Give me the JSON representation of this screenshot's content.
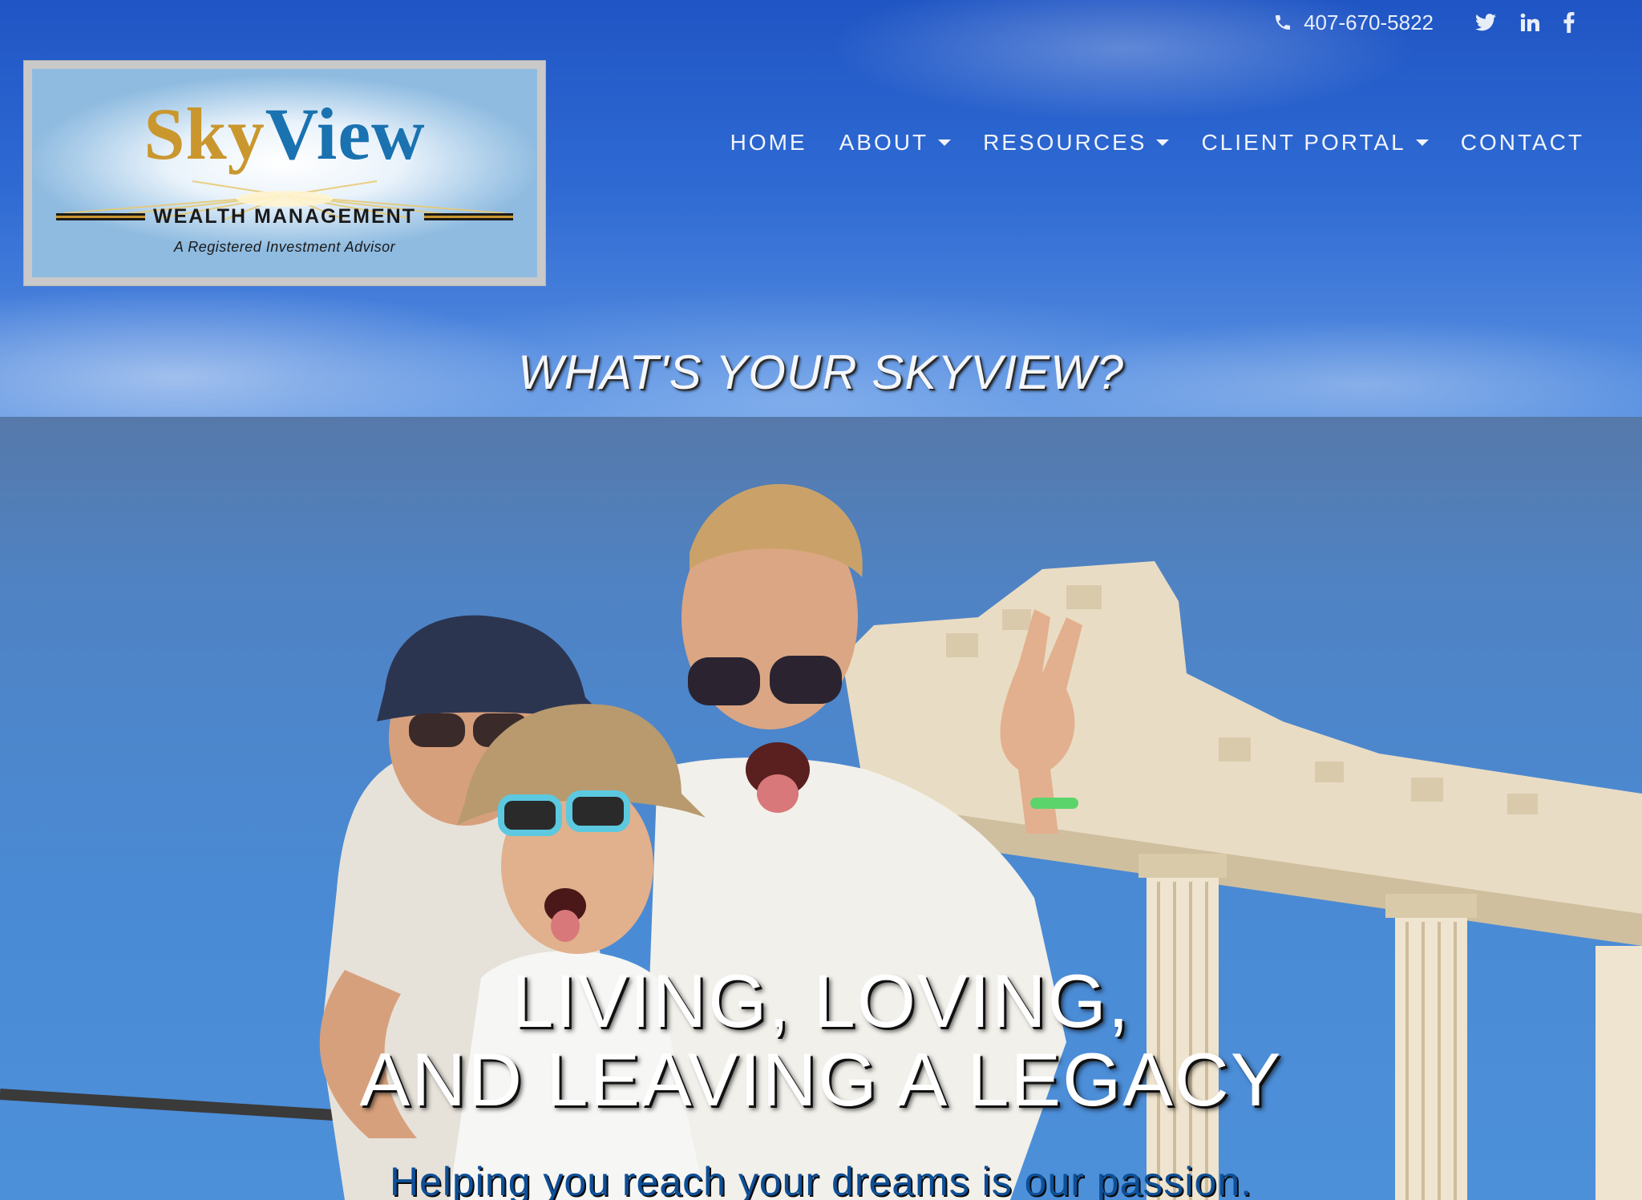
{
  "contact": {
    "phone": "407-670-5822"
  },
  "social": [
    {
      "name": "twitter",
      "icon": "twitter-icon"
    },
    {
      "name": "linkedin",
      "icon": "linkedin-icon"
    },
    {
      "name": "facebook",
      "icon": "facebook-icon"
    }
  ],
  "logo": {
    "title_part1": "Sky",
    "title_part2": "View",
    "subtitle": "WEALTH MANAGEMENT",
    "tagline": "A Registered Investment Advisor"
  },
  "nav": {
    "items": [
      {
        "label": "HOME",
        "dropdown": false
      },
      {
        "label": "ABOUT",
        "dropdown": true
      },
      {
        "label": "RESOURCES",
        "dropdown": true
      },
      {
        "label": "CLIENT PORTAL",
        "dropdown": true
      },
      {
        "label": "CONTACT",
        "dropdown": false
      }
    ]
  },
  "banner": {
    "tagline": "WHAT'S YOUR SKYVIEW?"
  },
  "hero": {
    "heading_line1": "LIVING, LOVING,",
    "heading_line2": "AND LEAVING A LEGACY",
    "subheading": "Helping you reach your dreams is our passion."
  },
  "colors": {
    "sky_blue": "#2f6ad3",
    "logo_gold": "#c9972e",
    "logo_blue": "#1a72b0",
    "nav_text": "#f2f5fb",
    "subheading_blue": "#0e4f96"
  }
}
